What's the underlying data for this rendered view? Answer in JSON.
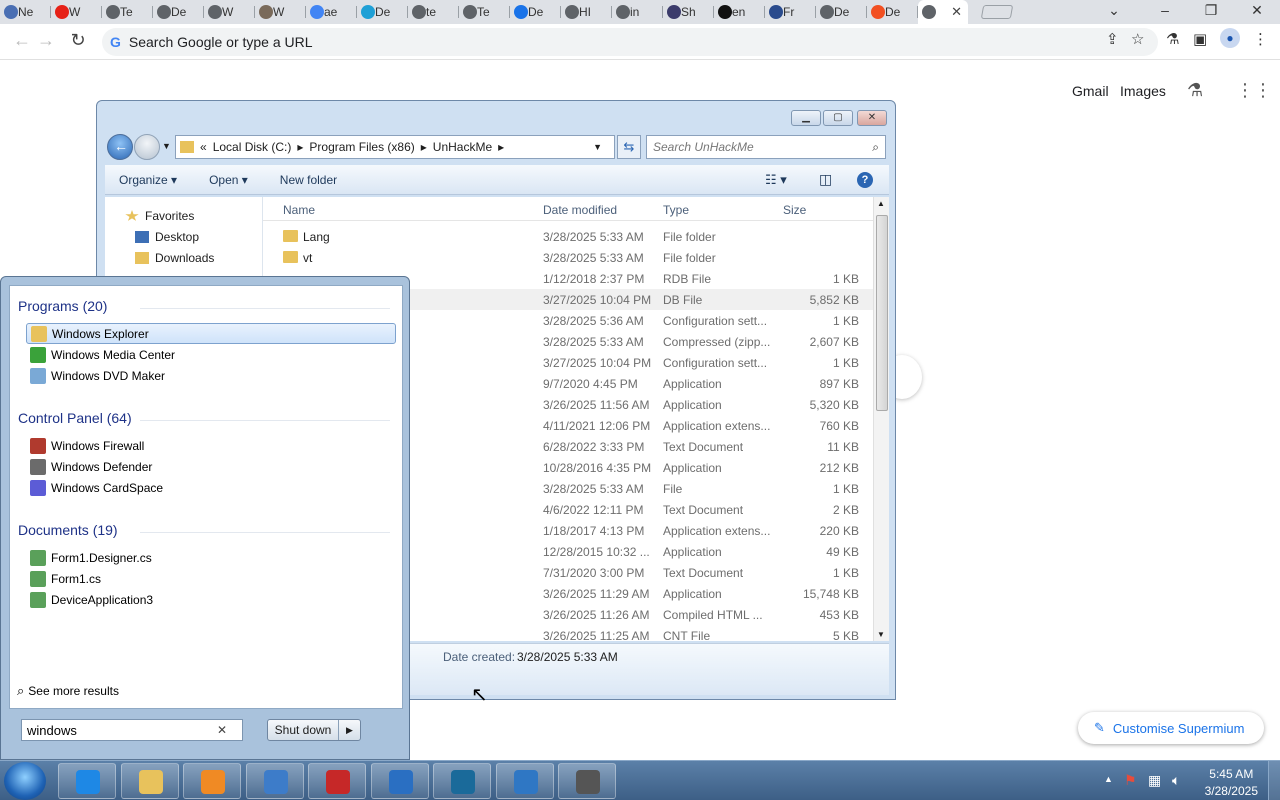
{
  "browser": {
    "tabs": [
      {
        "label": "Ne",
        "fav": "#4a6fb3"
      },
      {
        "label": "W",
        "fav": "#e62117"
      },
      {
        "label": "Te",
        "fav": "#5f6368"
      },
      {
        "label": "De",
        "fav": "#5f6368"
      },
      {
        "label": "W",
        "fav": "#5f6368"
      },
      {
        "label": "W",
        "fav": "#7a6a5a"
      },
      {
        "label": "ae",
        "fav": "#4285f4"
      },
      {
        "label": "De",
        "fav": "#1fa0d6"
      },
      {
        "label": "te",
        "fav": "#5f6368"
      },
      {
        "label": "Te",
        "fav": "#5f6368"
      },
      {
        "label": "De",
        "fav": "#1a73e8"
      },
      {
        "label": "HI",
        "fav": "#5f6368"
      },
      {
        "label": "in",
        "fav": "#5f6368"
      },
      {
        "label": "Sh",
        "fav": "#3b3b6b"
      },
      {
        "label": "en",
        "fav": "#111111"
      },
      {
        "label": "Fr",
        "fav": "#2a4b8d"
      },
      {
        "label": "De",
        "fav": "#5f6368"
      },
      {
        "label": "De",
        "fav": "#f25022"
      }
    ],
    "omnibox_placeholder": "Search Google or type a URL",
    "links": {
      "gmail": "Gmail",
      "images": "Images"
    },
    "customise_label": "Customise Supermium"
  },
  "explorer": {
    "breadcrumb": [
      "«",
      "Local Disk (C:)",
      "▸",
      "Program Files (x86)",
      "▸",
      "UnHackMe",
      "▸"
    ],
    "search_placeholder": "Search UnHackMe",
    "commands": {
      "organize": "Organize ▾",
      "open": "Open ▾",
      "new_folder": "New folder"
    },
    "nav": {
      "favorites": "Favorites",
      "desktop": "Desktop",
      "downloads": "Downloads"
    },
    "columns": {
      "name": "Name",
      "date": "Date modified",
      "type": "Type",
      "size": "Size"
    },
    "rows": [
      {
        "name": "Lang",
        "date": "3/28/2025 5:33 AM",
        "type": "File folder",
        "size": "",
        "folder": true
      },
      {
        "name": "vt",
        "date": "3/28/2025 5:33 AM",
        "type": "File folder",
        "size": "",
        "folder": true
      },
      {
        "name": "",
        "date": "1/12/2018 2:37 PM",
        "type": "RDB File",
        "size": "1 KB"
      },
      {
        "name": "",
        "date": "3/27/2025 10:04 PM",
        "type": "DB File",
        "size": "5,852 KB",
        "sel": true
      },
      {
        "name": "",
        "date": "3/28/2025 5:36 AM",
        "type": "Configuration sett...",
        "size": "1 KB"
      },
      {
        "name": "",
        "date": "3/28/2025 5:33 AM",
        "type": "Compressed (zipp...",
        "size": "2,607 KB"
      },
      {
        "name": "",
        "date": "3/27/2025 10:04 PM",
        "type": "Configuration sett...",
        "size": "1 KB"
      },
      {
        "name": "",
        "date": "9/7/2020 4:45 PM",
        "type": "Application",
        "size": "897 KB"
      },
      {
        "name": "",
        "date": "3/26/2025 11:56 AM",
        "type": "Application",
        "size": "5,320 KB"
      },
      {
        "name": "",
        "date": "4/11/2021 12:06 PM",
        "type": "Application extens...",
        "size": "760 KB"
      },
      {
        "name": "",
        "date": "6/28/2022 3:33 PM",
        "type": "Text Document",
        "size": "11 KB"
      },
      {
        "name": "",
        "date": "10/28/2016 4:35 PM",
        "type": "Application",
        "size": "212 KB"
      },
      {
        "name": "",
        "date": "3/28/2025 5:33 AM",
        "type": "File",
        "size": "1 KB"
      },
      {
        "name": "",
        "date": "4/6/2022 12:11 PM",
        "type": "Text Document",
        "size": "2 KB"
      },
      {
        "name": "",
        "date": "1/18/2017 4:13 PM",
        "type": "Application extens...",
        "size": "220 KB"
      },
      {
        "name": "",
        "date": "12/28/2015 10:32 ...",
        "type": "Application",
        "size": "49 KB"
      },
      {
        "name": "",
        "date": "7/31/2020 3:00 PM",
        "type": "Text Document",
        "size": "1 KB"
      },
      {
        "name": "",
        "date": "3/26/2025 11:29 AM",
        "type": "Application",
        "size": "15,748 KB"
      },
      {
        "name": "",
        "date": "3/26/2025 11:26 AM",
        "type": "Compiled HTML ...",
        "size": "453 KB"
      },
      {
        "name": "",
        "date": "3/26/2025 11:25 AM",
        "type": "CNT File",
        "size": "5 KB"
      }
    ],
    "details_label": "Date created:",
    "details_value": "3/28/2025 5:33 AM"
  },
  "startmenu": {
    "groups": [
      {
        "title": "Programs (20)",
        "items": [
          {
            "label": "Windows Explorer",
            "color": "#e8c25c",
            "hl": true
          },
          {
            "label": "Windows Media Center",
            "color": "#3aa23a"
          },
          {
            "label": "Windows DVD Maker",
            "color": "#7aa9d6"
          }
        ]
      },
      {
        "title": "Control Panel (64)",
        "items": [
          {
            "label": "Windows Firewall",
            "color": "#b03a2e"
          },
          {
            "label": "Windows Defender",
            "color": "#6b6b6b"
          },
          {
            "label": "Windows CardSpace",
            "color": "#5c5cd6"
          }
        ]
      },
      {
        "title": "Documents (19)",
        "items": [
          {
            "label": "Form1.Designer.cs",
            "color": "#5aa05a"
          },
          {
            "label": "Form1.cs",
            "color": "#5aa05a"
          },
          {
            "label": "DeviceApplication3",
            "color": "#5aa05a"
          }
        ]
      }
    ],
    "see_more": "See more results",
    "search_value": "windows",
    "shutdown_label": "Shut down"
  },
  "taskbar": {
    "items": [
      {
        "name": "ie",
        "color": "#1e88e5"
      },
      {
        "name": "explorer",
        "color": "#e8c25c"
      },
      {
        "name": "media-player",
        "color": "#f08a24"
      },
      {
        "name": "remote-desktop",
        "color": "#3d7cc9"
      },
      {
        "name": "toolbox",
        "color": "#c62828"
      },
      {
        "name": "control-panel",
        "color": "#2a6fc2"
      },
      {
        "name": "network-globe",
        "color": "#1a6a9a"
      },
      {
        "name": "device",
        "color": "#2f77c4"
      },
      {
        "name": "spy-tool",
        "color": "#555555"
      }
    ],
    "time": "5:45 AM",
    "date": "3/28/2025"
  }
}
